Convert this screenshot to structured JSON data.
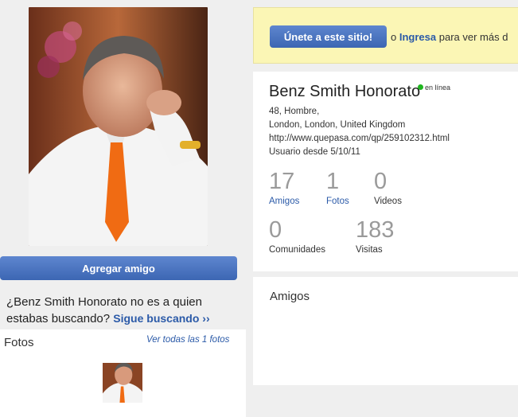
{
  "profile": {
    "name": "Benz Smith Honorato",
    "online_status": "en línea",
    "details": "48, Hombre,",
    "location": "London, London, United Kingdom",
    "url": "http://www.quepasa.com/qp/259102312.html",
    "member_since": "Usuario desde 5/10/11"
  },
  "stats": [
    {
      "value": "17",
      "label": "Amigos"
    },
    {
      "value": "1",
      "label": "Fotos"
    },
    {
      "value": "0",
      "label": "Videos"
    },
    {
      "value": "0",
      "label": "Comunidades"
    },
    {
      "value": "183",
      "label": "Visitas"
    }
  ],
  "actions": {
    "add_friend": "Agregar amigo",
    "join": "Únete a este sitio!",
    "join_or": "o",
    "login": "Ingresa",
    "join_suffix": "para ver más d"
  },
  "not_who": {
    "question": "¿Benz Smith Honorato no es a quien estabas buscando?",
    "link": "Sigue buscando ››"
  },
  "photos": {
    "title": "Fotos",
    "see_all": "Ver todas las 1 fotos"
  },
  "friends": {
    "title": "Amigos"
  },
  "colors": {
    "accent": "#3c66b3",
    "link": "#2b5aa8",
    "notice_bg": "#fbf6b5",
    "online": "#1fb51f"
  }
}
